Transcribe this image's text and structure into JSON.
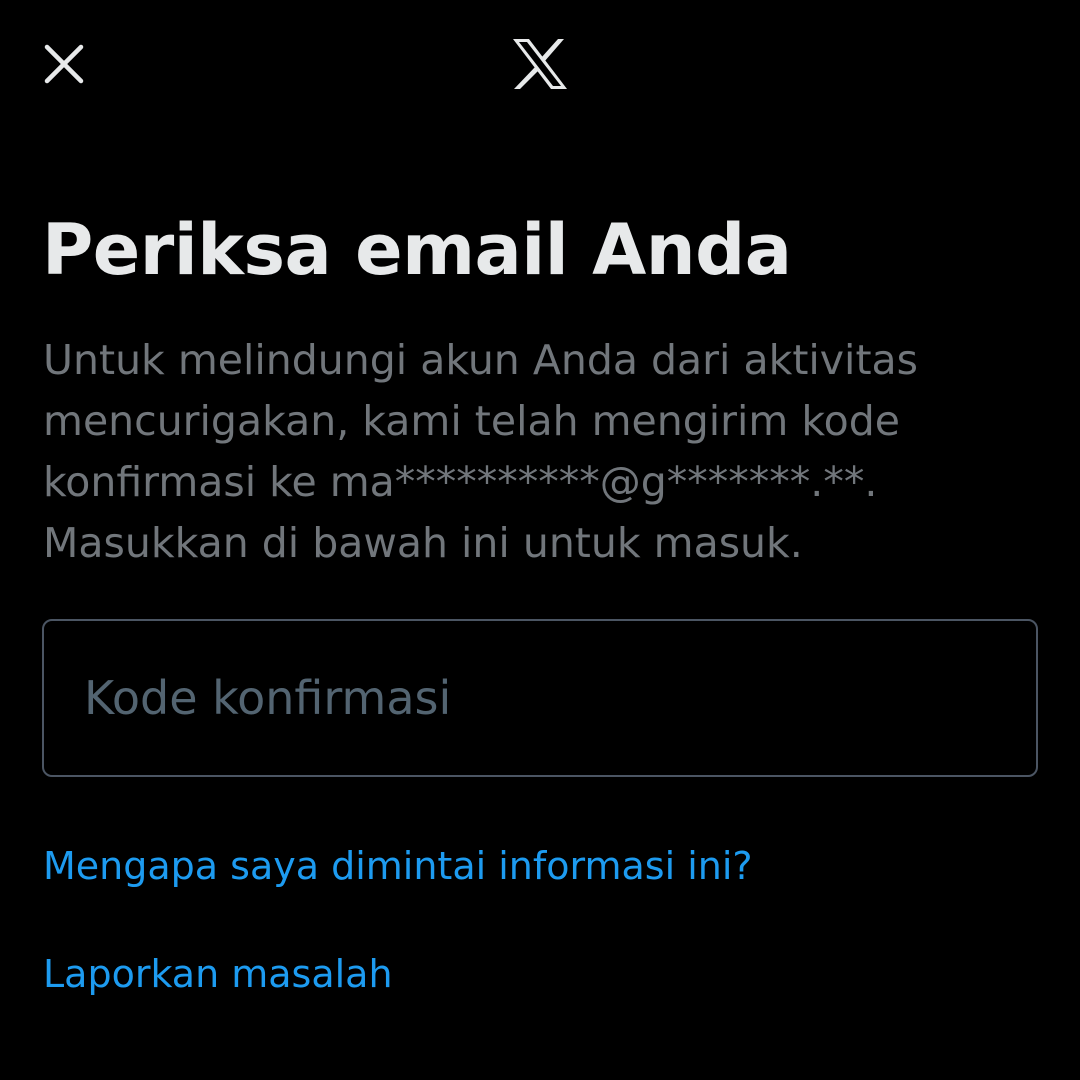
{
  "header": {
    "close_icon": "close-icon",
    "logo_icon": "x-logo-icon"
  },
  "main": {
    "title": "Periksa email Anda",
    "description": "Untuk melindungi akun Anda dari aktivitas mencurigakan, kami telah mengirim kode konfirmasi ke ma**********@g*******.**. Masukkan di bawah ini untuk masuk.",
    "code_input": {
      "placeholder": "Kode konfirmasi",
      "value": ""
    },
    "links": {
      "why_asked": "Mengapa saya dimintai informasi ini?",
      "report_problem": "Laporkan masalah"
    }
  },
  "colors": {
    "background": "#000000",
    "primary_text": "#e7e9ea",
    "secondary_text": "#71767b",
    "placeholder": "#536471",
    "input_border": "#4b5563",
    "link": "#1d9bf0"
  }
}
